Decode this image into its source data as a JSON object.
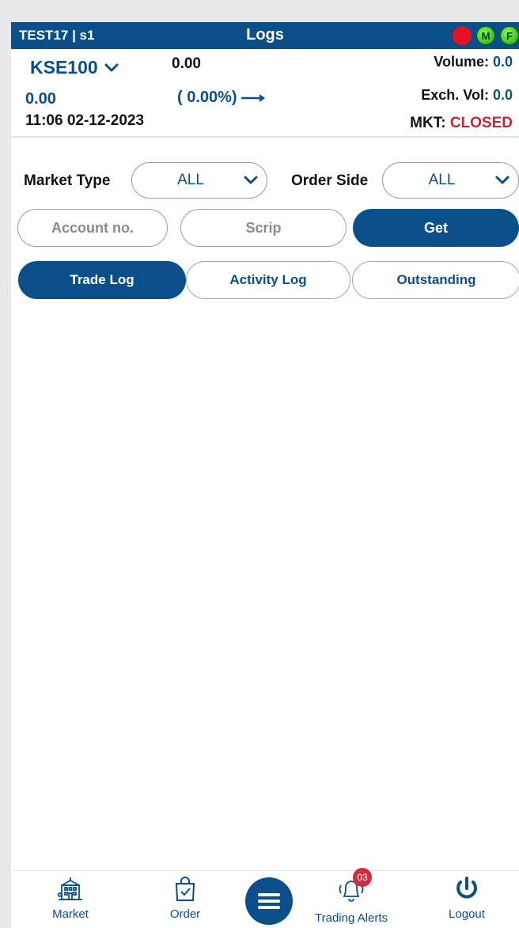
{
  "titlebar": {
    "account": "TEST17 | s1",
    "title": "Logs",
    "status_m": "M",
    "status_f": "F"
  },
  "market": {
    "index_name": "KSE100",
    "index_value": "0.00",
    "volume_label": "Volume:",
    "volume_value": "0.0",
    "change": "0.00",
    "change_pct": "( 0.00%)",
    "exch_vol_label": "Exch. Vol:",
    "exch_vol_value": "0.0",
    "timestamp": "11:06 02-12-2023",
    "mkt_label": "MKT:",
    "mkt_status": "CLOSED"
  },
  "filters": {
    "market_type_label": "Market Type",
    "market_type_value": "ALL",
    "order_side_label": "Order Side",
    "order_side_value": "ALL",
    "account_placeholder": "Account no.",
    "scrip_placeholder": "Scrip",
    "get_label": "Get"
  },
  "tabs": [
    {
      "label": "Trade Log",
      "active": true
    },
    {
      "label": "Activity Log",
      "active": false
    },
    {
      "label": "Outstanding",
      "active": false
    }
  ],
  "nav": {
    "market": "Market",
    "order": "Order",
    "alerts": "Trading Alerts",
    "alerts_badge": "03",
    "logout": "Logout"
  },
  "colors": {
    "primary": "#0b4f8a",
    "closed": "#c0283a",
    "status_red": "#e81123",
    "status_green": "#2fbf1a"
  }
}
